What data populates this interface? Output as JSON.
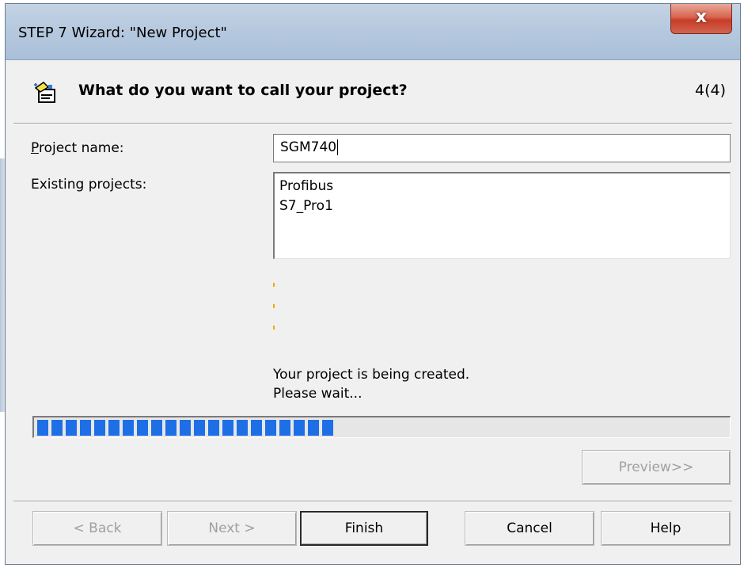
{
  "window": {
    "title": "STEP 7 Wizard: \"New Project\"",
    "close_label": "x"
  },
  "header": {
    "question": "What do you want to call your project?",
    "step_indicator": "4(4)",
    "icon": "wizard-hat-icon"
  },
  "form": {
    "project_name_label_first": "P",
    "project_name_label_rest": "roject name:",
    "project_name_value": "SGM740",
    "existing_projects_label": "Existing projects:",
    "existing_projects": [
      "Profibus",
      "S7_Pro1"
    ]
  },
  "status": {
    "line1": "Your project is being created.",
    "line2": "Please wait..."
  },
  "progress": {
    "fraction": 0.43,
    "color": "#1e6fe6"
  },
  "buttons": {
    "preview": "Preview>>",
    "back": "< Back",
    "next": "Next >",
    "finish": "Finish",
    "cancel": "Cancel",
    "help": "Help"
  }
}
